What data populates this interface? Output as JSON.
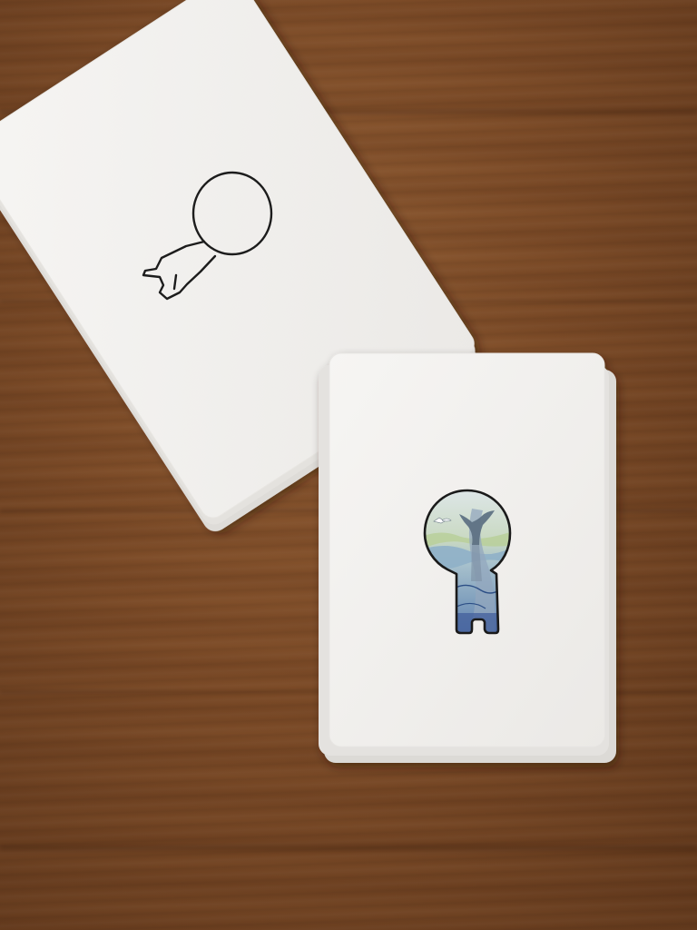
{
  "scene": {
    "description_colors": {
      "table": "#7c4b27",
      "card": "#f2f1ef",
      "card_edge": "#dcdad6",
      "outline": "#1c1c1c"
    },
    "objects": {
      "left_stack": {
        "card_count": 2,
        "illustration": "outline-figure-icon",
        "colored": false
      },
      "right_stack": {
        "card_count": 3,
        "illustration": "whale-landscape-figure-icon",
        "colored": true
      }
    }
  }
}
